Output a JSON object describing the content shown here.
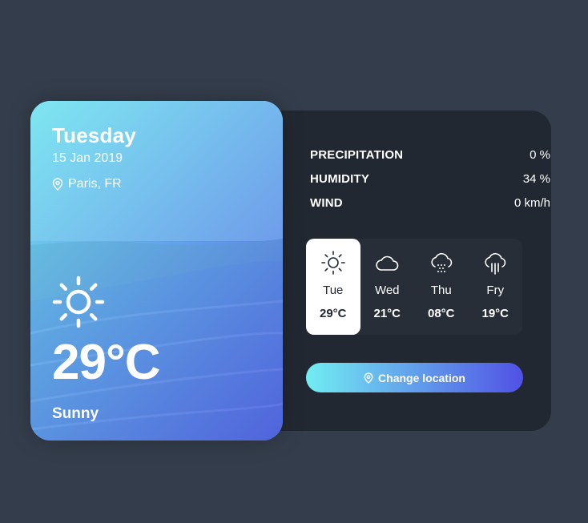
{
  "card": {
    "day_name": "Tuesday",
    "date": "15 Jan 2019",
    "location": "Paris, FR",
    "location_icon": "map-pin-icon",
    "weather_icon": "sun-icon",
    "temperature": "29°C",
    "description": "Sunny",
    "gradient_start": "#72edf2",
    "gradient_end": "#5151e5"
  },
  "stats": [
    {
      "title": "PRECIPITATION",
      "value": "0 %"
    },
    {
      "title": "HUMIDITY",
      "value": "34 %"
    },
    {
      "title": "WIND",
      "value": "0 km/h"
    }
  ],
  "week": [
    {
      "day": "Tue",
      "temp": "29°C",
      "icon": "sun-icon",
      "active": true
    },
    {
      "day": "Wed",
      "temp": "21°C",
      "icon": "cloud-icon",
      "active": false
    },
    {
      "day": "Thu",
      "temp": "08°C",
      "icon": "cloud-snow-icon",
      "active": false
    },
    {
      "day": "Fry",
      "temp": "19°C",
      "icon": "cloud-rain-icon",
      "active": false
    }
  ],
  "button": {
    "label": "Change location",
    "icon": "map-pin-icon"
  },
  "colors": {
    "background": "#343d4b",
    "panel": "#222831",
    "week_bg": "#272e37",
    "active_day_bg": "#ffffff"
  }
}
